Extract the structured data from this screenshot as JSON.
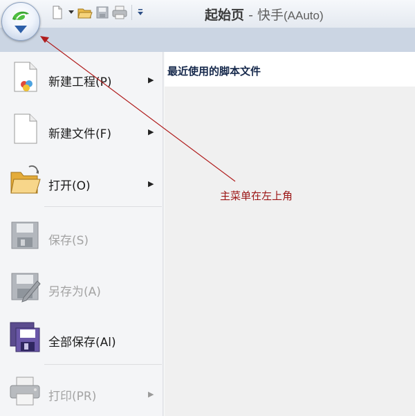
{
  "window": {
    "title_main": "起始页",
    "title_separator": "-",
    "app_name": "快手",
    "app_name_en": "(AAuto)"
  },
  "menu": {
    "items": [
      {
        "label": "新建工程(P)",
        "has_submenu": true,
        "enabled": true,
        "icon": "new-project-icon"
      },
      {
        "label": "新建文件(F)",
        "has_submenu": true,
        "enabled": true,
        "icon": "new-file-icon"
      },
      {
        "label": "打开(O)",
        "has_submenu": true,
        "enabled": true,
        "icon": "open-folder-icon"
      },
      {
        "label": "保存(S)",
        "has_submenu": false,
        "enabled": false,
        "icon": "save-icon"
      },
      {
        "label": "另存为(A)",
        "has_submenu": false,
        "enabled": false,
        "icon": "save-as-icon"
      },
      {
        "label": "全部保存(Al)",
        "has_submenu": false,
        "enabled": true,
        "icon": "save-all-icon"
      },
      {
        "label": "打印(PR)",
        "has_submenu": true,
        "enabled": false,
        "icon": "print-icon"
      }
    ],
    "submenu_arrow": "▶"
  },
  "recent": {
    "title": "最近使用的脚本文件",
    "files": []
  },
  "annotation": {
    "text": "主菜单在左上角",
    "color": "#9b1515"
  },
  "colors": {
    "menu_bg": "#f4f5f7",
    "strip_bg": "#cbd5e3",
    "orb_logo_green": "#3aa631",
    "orb_arrow_blue": "#2d5fa8"
  }
}
